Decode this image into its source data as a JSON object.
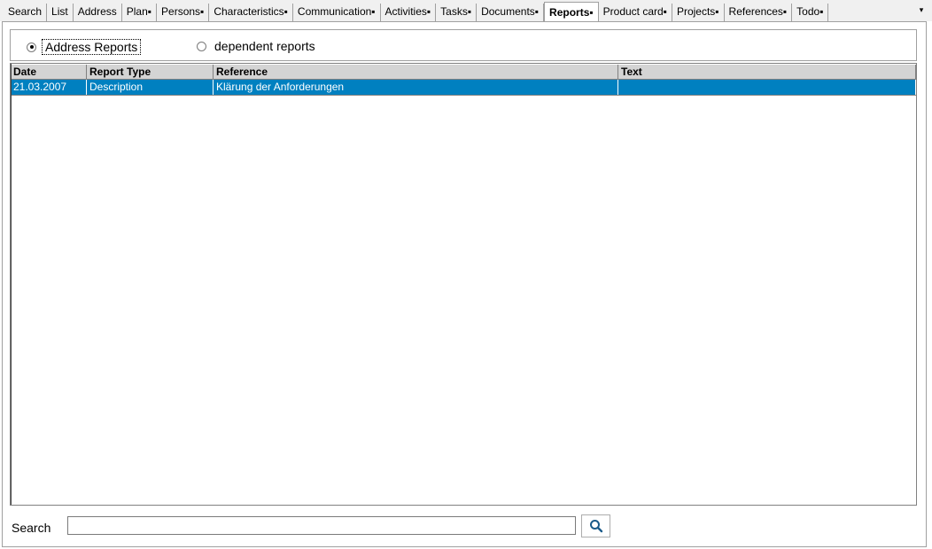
{
  "tabs": [
    {
      "label": "Search"
    },
    {
      "label": "List"
    },
    {
      "label": "Address"
    },
    {
      "label": "Plan▪"
    },
    {
      "label": "Persons▪"
    },
    {
      "label": "Characteristics▪"
    },
    {
      "label": "Communication▪"
    },
    {
      "label": "Activities▪"
    },
    {
      "label": "Tasks▪"
    },
    {
      "label": "Documents▪"
    },
    {
      "label": "Reports▪"
    },
    {
      "label": "Product card▪"
    },
    {
      "label": "Projects▪"
    },
    {
      "label": "References▪"
    },
    {
      "label": "Todo▪"
    }
  ],
  "active_tab": "Reports▪",
  "tab_overflow_icon": "▾",
  "report_mode": {
    "options": [
      {
        "label": "Address Reports",
        "checked": true
      },
      {
        "label": "dependent reports",
        "checked": false
      }
    ]
  },
  "grid": {
    "columns": [
      "Date",
      "Report Type",
      "Reference",
      "Text"
    ],
    "rows": [
      [
        "21.03.2007",
        "Description",
        "Klärung der Anforderungen",
        ""
      ]
    ],
    "selected_row_color": "#0080c0"
  },
  "search": {
    "label": "Search",
    "value": "",
    "button_icon": "search-icon"
  }
}
